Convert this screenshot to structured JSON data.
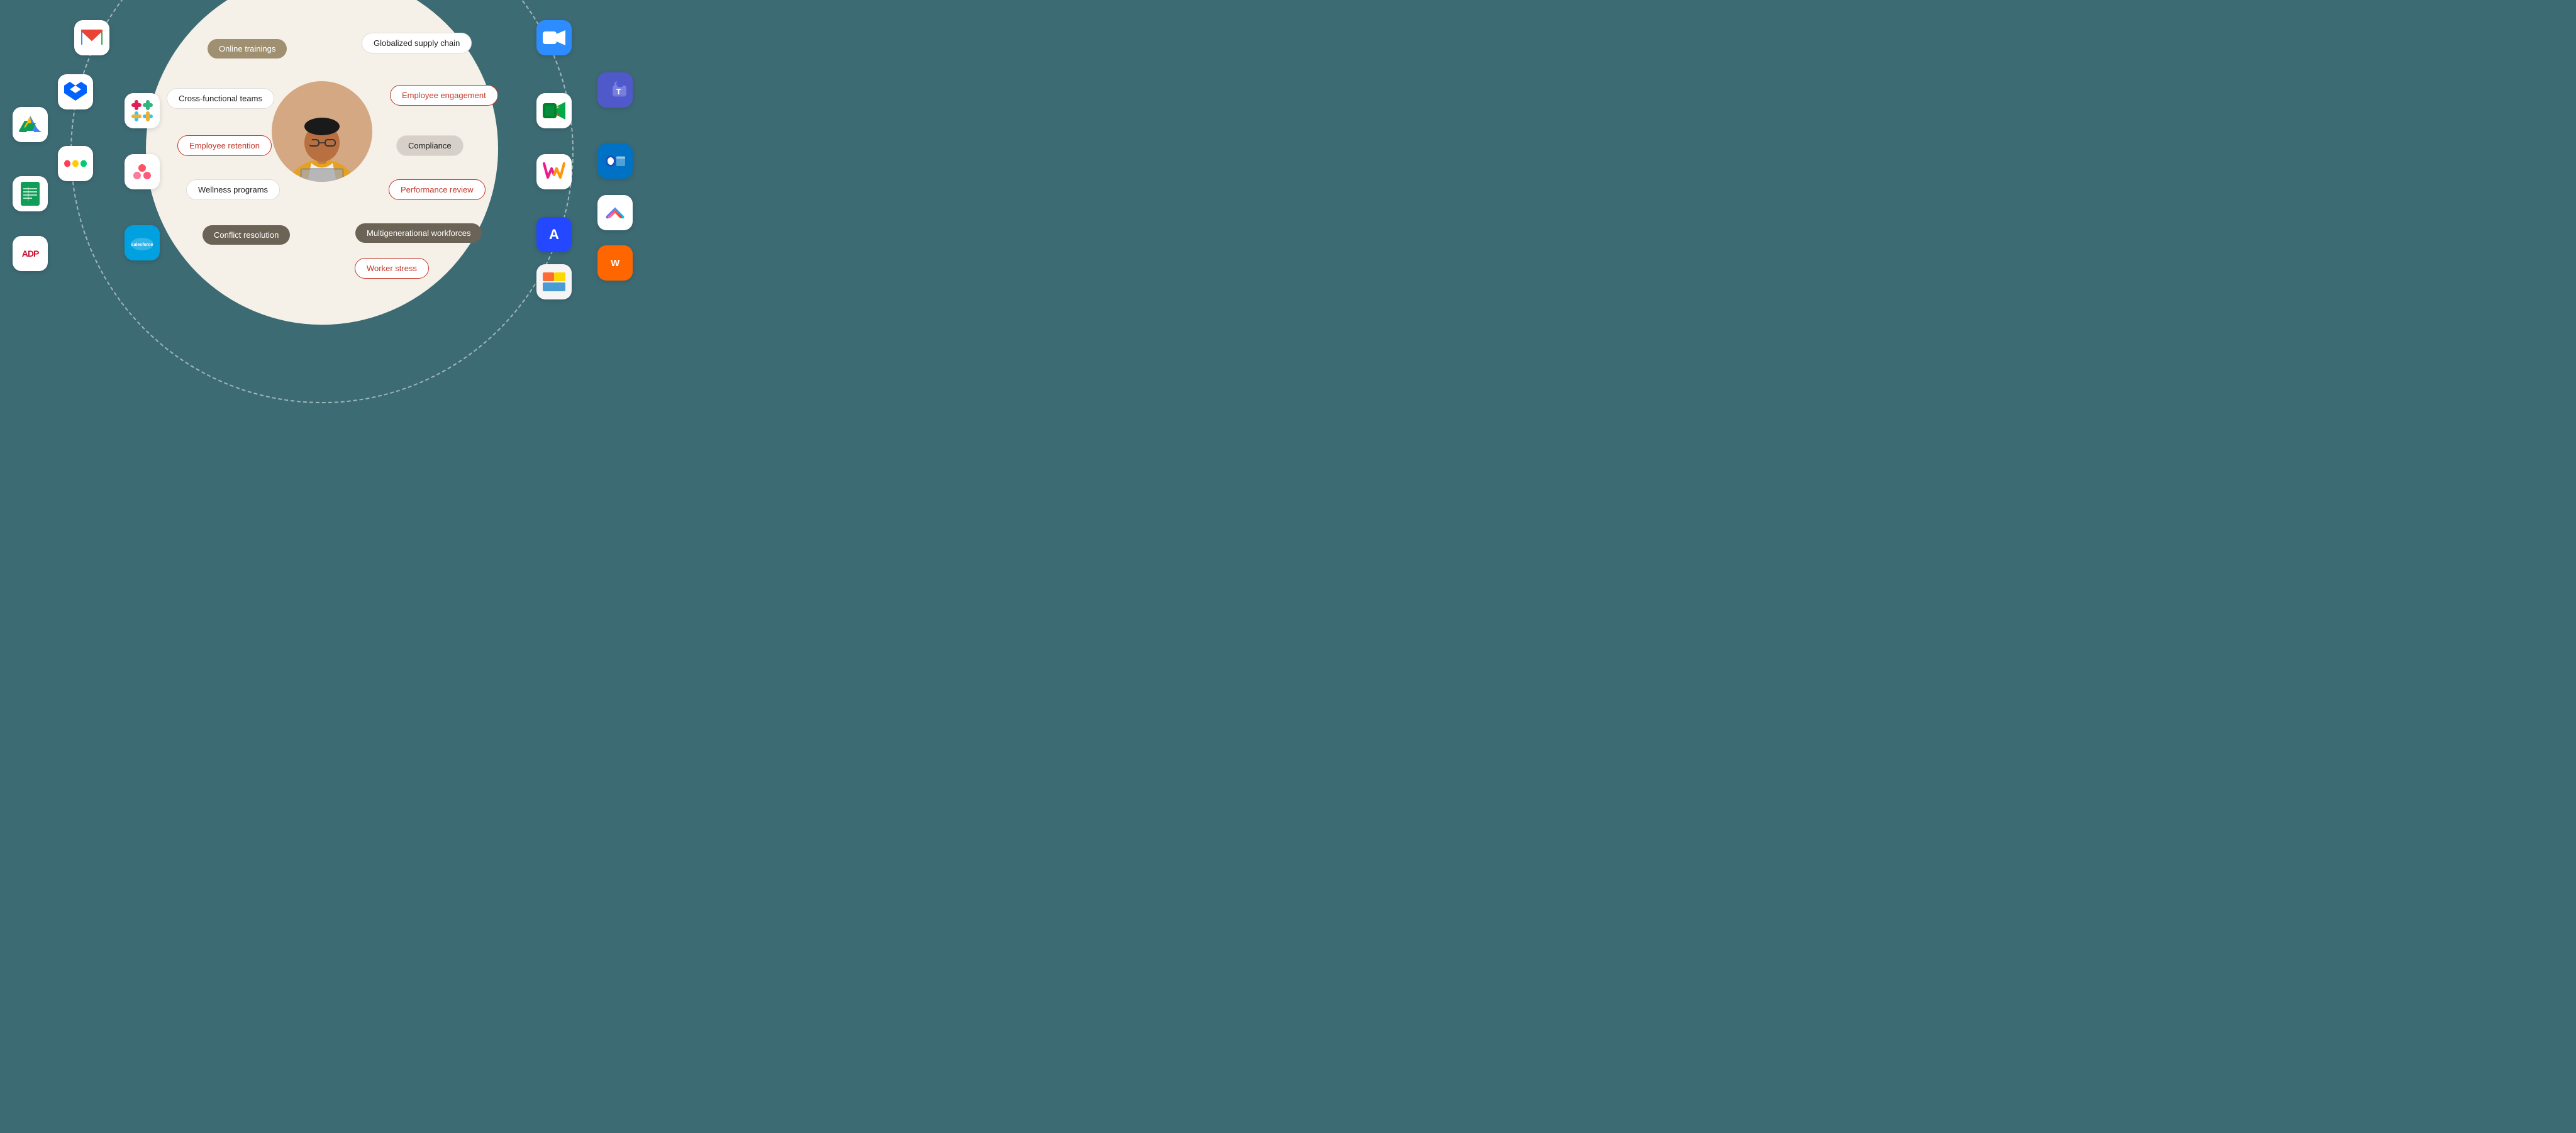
{
  "bg_color": "#3d6b74",
  "pills": {
    "online_trainings": "Online trainings",
    "globalized_supply_chain": "Globalized supply chain",
    "cross_functional_teams": "Cross-functional teams",
    "employee_engagement": "Employee engagement",
    "employee_retention": "Employee retention",
    "compliance": "Compliance",
    "wellness_programs": "Wellness programs",
    "performance_review": "Performance review",
    "conflict_resolution": "Conflict resolution",
    "multigenerational_workforces": "Multigenerational workforces",
    "worker_stress": "Worker stress"
  },
  "left_icons": [
    {
      "name": "google-drive-icon",
      "label": "Google Drive"
    },
    {
      "name": "google-docs-icon",
      "label": "Google Sheets"
    },
    {
      "name": "adp-icon",
      "label": "ADP"
    },
    {
      "name": "gmail-icon",
      "label": "Gmail"
    },
    {
      "name": "dropbox-icon",
      "label": "Dropbox"
    },
    {
      "name": "monday-icon",
      "label": "Monday.com"
    },
    {
      "name": "slack-icon",
      "label": "Slack"
    },
    {
      "name": "three-dot-icon",
      "label": "Three Dot App"
    },
    {
      "name": "salesforce-icon",
      "label": "Salesforce"
    }
  ],
  "right_icons": [
    {
      "name": "zoom-icon",
      "label": "Zoom"
    },
    {
      "name": "teams-icon",
      "label": "Microsoft Teams"
    },
    {
      "name": "google-meet-icon",
      "label": "Google Meet"
    },
    {
      "name": "outlook-icon",
      "label": "Outlook"
    },
    {
      "name": "clickup-icon",
      "label": "ClickUp"
    },
    {
      "name": "workvivo-icon",
      "label": "Workvivo"
    },
    {
      "name": "wps-icon",
      "label": "WPS Office"
    },
    {
      "name": "arara-icon",
      "label": "Arara"
    },
    {
      "name": "stack-icon",
      "label": "Stack"
    }
  ]
}
